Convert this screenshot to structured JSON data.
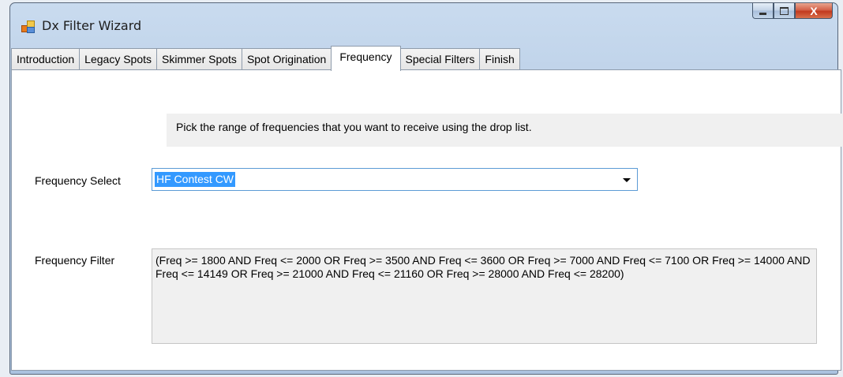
{
  "window": {
    "title": "Dx Filter Wizard",
    "controls": {
      "minimize": "minimize",
      "maximize": "maximize",
      "close": "X"
    }
  },
  "tabs": [
    {
      "label": "Introduction",
      "active": false
    },
    {
      "label": "Legacy Spots",
      "active": false
    },
    {
      "label": "Skimmer Spots",
      "active": false
    },
    {
      "label": "Spot Origination",
      "active": false
    },
    {
      "label": "Frequency",
      "active": true
    },
    {
      "label": "Special Filters",
      "active": false
    },
    {
      "label": "Finish",
      "active": false
    }
  ],
  "frequency_page": {
    "instruction": "Pick the range of frequencies that you want to receive using the drop list.",
    "select_label": "Frequency Select",
    "select_value": "HF Contest CW",
    "filter_label": "Frequency Filter",
    "filter_value": "(Freq >= 1800 AND Freq <= 2000 OR Freq >= 3500 AND Freq <= 3600 OR Freq >= 7000 AND Freq <= 7100 OR Freq >= 14000 AND Freq <= 14149 OR Freq >= 21000 AND Freq <= 21160 OR Freq >= 28000 AND Freq <= 28200)"
  },
  "colors": {
    "selection_highlight": "#3399ff",
    "focus_border": "#5c9bd6",
    "close_button": "#c2391e"
  }
}
